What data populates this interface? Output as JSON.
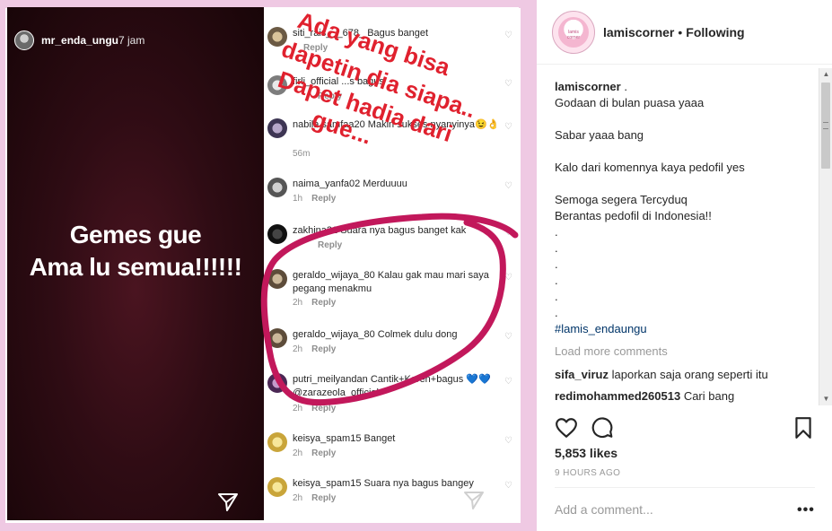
{
  "story": {
    "username": "mr_enda_ungu",
    "time": "7 jam",
    "text_line1": "Gemes gue",
    "text_line2": "Ama lu semua!!!!!!"
  },
  "comments": [
    {
      "user": "siti_rais___678_",
      "text": "Bagus banget",
      "meta": "",
      "reply": "Reply"
    },
    {
      "user": "firli_official",
      "text": "...s bagus",
      "meta": "",
      "reply": "Reply"
    },
    {
      "user": "nabila.samfaa20",
      "text": "Makin sukses nyanyinya😉👌",
      "meta": "56m",
      "reply": "Reply"
    },
    {
      "user": "naima_yanfa02",
      "text": "Merduuuu",
      "meta": "1h",
      "reply": "Reply"
    },
    {
      "user": "zakhina21",
      "text": "Suara nya bagus banget kak",
      "meta": "",
      "reply": "Reply"
    },
    {
      "user": "geraldo_wijaya_80",
      "text": "Kalau gak mau mari saya pegang menakmu",
      "meta": "2h",
      "reply": "Reply"
    },
    {
      "user": "geraldo_wijaya_80",
      "text": "Colmek dulu dong",
      "meta": "2h",
      "reply": "Reply"
    },
    {
      "user": "putri_meilyandan",
      "text": "Cantik+Keren+bagus 💙💙 @zarazeola_official",
      "meta": "2h",
      "reply": "Reply"
    },
    {
      "user": "keisya_spam15",
      "text": "Banget",
      "meta": "2h",
      "reply": "Reply"
    },
    {
      "user": "keisya_spam15",
      "text": "Suara nya bagus bangey",
      "meta": "2h",
      "reply": "Reply"
    }
  ],
  "overlay_text": {
    "line1": "Ada yang bisa",
    "line2": "dapetin dia siapa..",
    "line3": "Dapet hadia dari",
    "line4": "gue..."
  },
  "colors": {
    "overlay_red": "#e0212e",
    "circle_magenta": "#c2185b",
    "media_bg": "#efc9e3"
  },
  "post": {
    "username": "lamiscorner",
    "separator": "•",
    "follow_status": "Following",
    "avatar_text": "lamis corner",
    "caption_user": "lamiscorner",
    "caption_first": ".",
    "caption_lines": [
      "Godaan di bulan puasa yaaa",
      "",
      "Sabar yaaa bang",
      "",
      "Kalo dari komennya kaya pedofil yes",
      "",
      "Semoga segera Tercyduq",
      "Berantas pedofil di Indonesia!!",
      ".",
      ".",
      ".",
      ".",
      ".",
      "."
    ],
    "hashtag": "#lamis_endaungu",
    "load_more": "Load more comments",
    "recent_comments": [
      {
        "user": "sifa_viruz",
        "text": "laporkan saja orang seperti itu"
      },
      {
        "user": "redimohammed260513",
        "text": "Cari bang"
      }
    ],
    "likes": "5,853 likes",
    "time_ago": "9 HOURS AGO",
    "comment_placeholder": "Add a comment...",
    "more_label": "•••"
  },
  "icons": {
    "like": "heart-icon",
    "comment": "comment-bubble-icon",
    "save": "bookmark-icon",
    "share": "paper-plane-icon"
  }
}
